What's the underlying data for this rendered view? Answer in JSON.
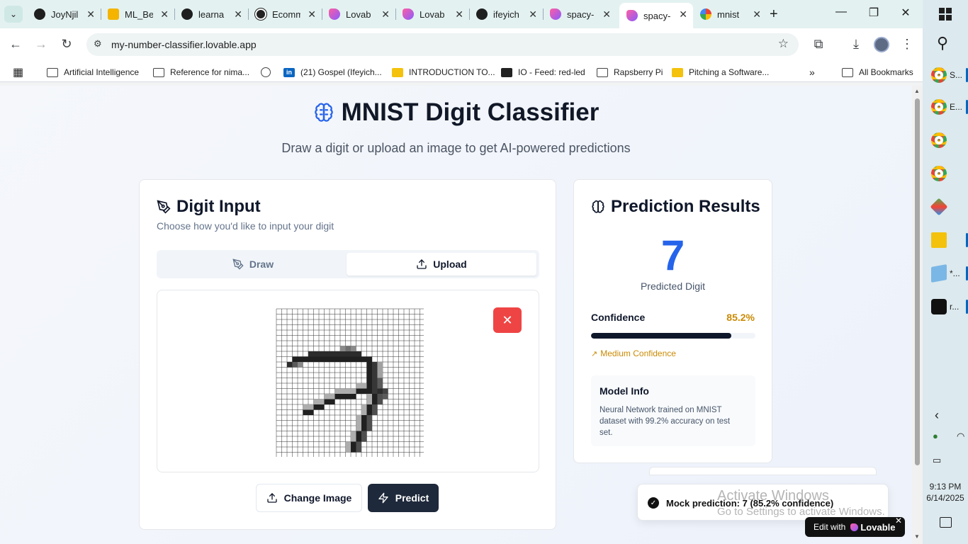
{
  "browser": {
    "tabs": [
      {
        "label": "JoyNjil",
        "icon": "github-icon"
      },
      {
        "label": "ML_Be",
        "icon": "colab-icon"
      },
      {
        "label": "learna",
        "icon": "github-icon"
      },
      {
        "label": "Ecomm",
        "icon": "openai-icon"
      },
      {
        "label": "Lovab",
        "icon": "lovable-icon"
      },
      {
        "label": "Lovab",
        "icon": "lovable-icon"
      },
      {
        "label": "ifeyich",
        "icon": "github-icon"
      },
      {
        "label": "spacy-",
        "icon": "lovable-icon"
      },
      {
        "label": "spacy-",
        "icon": "lovable-icon",
        "active": true
      },
      {
        "label": "mnist",
        "icon": "google-icon"
      }
    ],
    "url": "my-number-classifier.lovable.app",
    "bookmarks": [
      {
        "label": "Artificial Intelligence",
        "icon": "folder-icon"
      },
      {
        "label": "Reference for nima...",
        "icon": "folder-icon"
      },
      {
        "label": "",
        "icon": "globe-icon"
      },
      {
        "label": "(21) Gospel (Ifeyich...",
        "icon": "linkedin-icon"
      },
      {
        "label": "INTRODUCTION TO...",
        "icon": "slides-icon"
      },
      {
        "label": "IO - Feed: red-led",
        "icon": "io-icon"
      },
      {
        "label": "Rapsberry Pi",
        "icon": "folder-icon"
      },
      {
        "label": "Pitching a Software...",
        "icon": "slides-icon"
      }
    ],
    "all_bookmarks": "All Bookmarks",
    "more_bookmarks": "»"
  },
  "app": {
    "title": "MNIST Digit Classifier",
    "subtitle": "Draw a digit or upload an image to get AI-powered predictions",
    "input_card": {
      "title": "Digit Input",
      "description": "Choose how you'd like to input your digit",
      "tabs": [
        {
          "label": "Draw",
          "active": false
        },
        {
          "label": "Upload",
          "active": true
        }
      ],
      "remove_label": "✕",
      "change_label": "Change Image",
      "predict_label": "Predict"
    },
    "result_card": {
      "title": "Prediction Results",
      "digit": "7",
      "digit_label": "Predicted Digit",
      "confidence_label": "Confidence",
      "confidence_value": "85.2%",
      "confidence_fraction": 0.852,
      "confidence_level": "Medium Confidence",
      "model_title": "Model Info",
      "model_desc": "Neural Network trained on MNIST dataset with 99.2% accuracy on test set."
    },
    "toast": "Mock prediction: 7 (85.2% confidence)",
    "lovable_badge": {
      "prefix": "Edit with",
      "brand": "Lovable"
    }
  },
  "windows": {
    "watermark_title": "Activate Windows",
    "watermark_sub": "Go to Settings to activate Windows.",
    "taskbar_items": [
      {
        "label": "S...",
        "icon": "chrome-icon"
      },
      {
        "label": "E...",
        "icon": "chrome-icon"
      },
      {
        "label": "",
        "icon": "chrome-icon"
      },
      {
        "label": "",
        "icon": "chrome-icon"
      },
      {
        "label": "",
        "icon": "kite-icon"
      },
      {
        "label": "",
        "icon": "file-explorer-icon"
      },
      {
        "label": "*...",
        "icon": "notepad-icon"
      },
      {
        "label": "r...",
        "icon": "capcut-icon"
      }
    ],
    "time": "9:13 PM",
    "date": "6/14/2025"
  },
  "colors": {
    "accent_blue": "#2563eb",
    "danger": "#ef4444",
    "warning": "#ca8a04",
    "dark": "#1e293b"
  }
}
